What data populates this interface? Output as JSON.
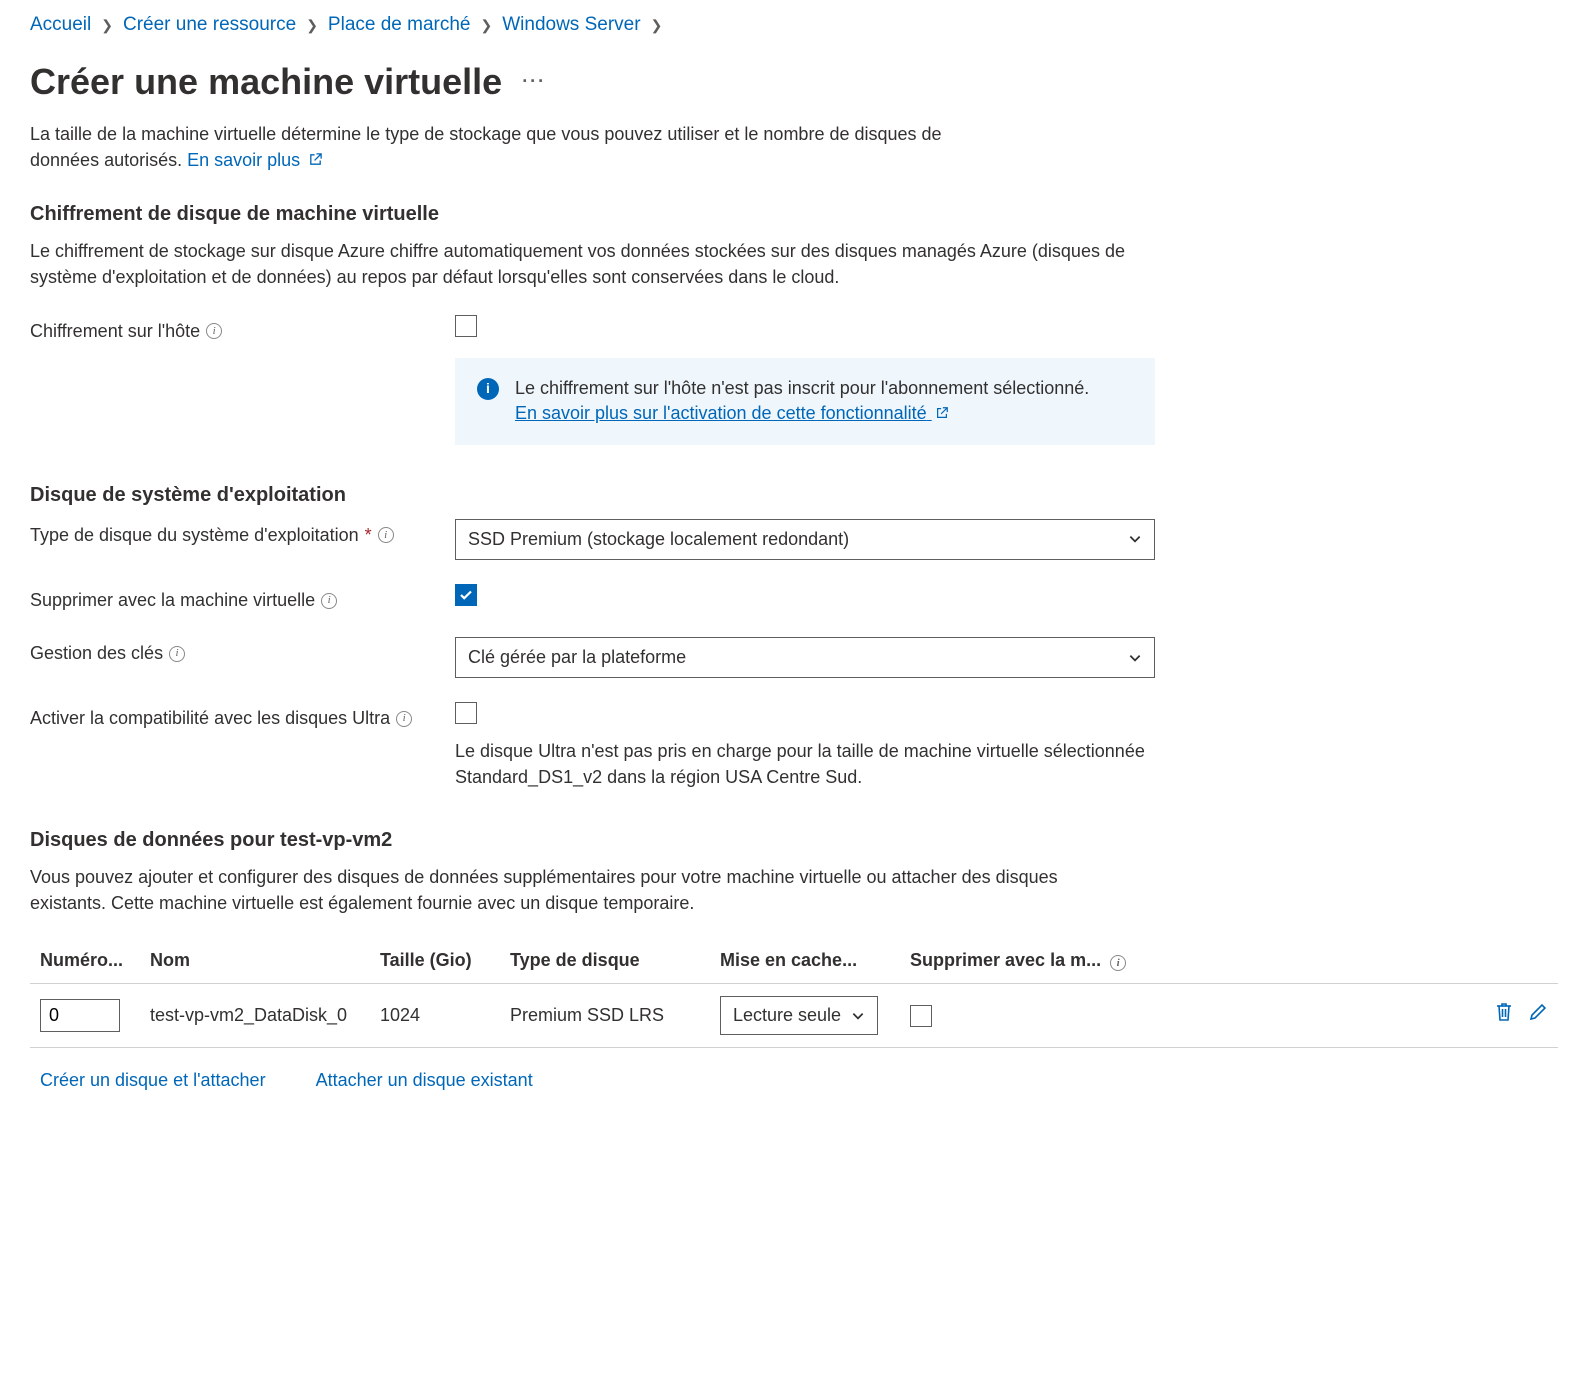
{
  "breadcrumb": {
    "items": [
      "Accueil",
      "Créer une ressource",
      "Place de marché",
      "Windows Server"
    ]
  },
  "page": {
    "title": "Créer une machine virtuelle",
    "intro_text": "La taille de la machine virtuelle détermine le type de stockage que vous pouvez utiliser et le nombre de disques de données autorisés. ",
    "learn_more": "En savoir plus"
  },
  "encryption": {
    "title": "Chiffrement de disque de machine virtuelle",
    "desc": "Le chiffrement de stockage sur disque Azure chiffre automatiquement vos données stockées sur des disques managés Azure (disques de système d'exploitation et de données) au repos par défaut lorsqu'elles sont conservées dans le cloud.",
    "host_label": "Chiffrement sur l'hôte",
    "callout_text": "Le chiffrement sur l'hôte n'est pas inscrit pour l'abonnement sélectionné.",
    "callout_link": "En savoir plus sur l'activation de cette fonctionnalité"
  },
  "osdisk": {
    "title": "Disque de système d'exploitation",
    "type_label": "Type de disque du système d'exploitation",
    "type_value": "SSD Premium (stockage localement redondant)",
    "delete_label": "Supprimer avec la machine virtuelle",
    "keys_label": "Gestion des clés",
    "keys_value": "Clé gérée par la plateforme",
    "ultra_label": "Activer la compatibilité avec les disques Ultra",
    "ultra_help": "Le disque Ultra n'est pas pris en charge pour la taille de machine virtuelle sélectionnée Standard_DS1_v2 dans la région USA Centre Sud."
  },
  "datadisks": {
    "title": "Disques de données pour test-vp-vm2",
    "desc": "Vous pouvez ajouter et configurer des disques de données supplémentaires pour votre machine virtuelle ou attacher des disques existants. Cette machine virtuelle est également fournie avec un disque temporaire.",
    "headers": {
      "lun": "Numéro...",
      "name": "Nom",
      "size": "Taille (Gio)",
      "type": "Type de disque",
      "cache": "Mise en cache...",
      "delete": "Supprimer avec la m..."
    },
    "row": {
      "lun": "0",
      "name": "test-vp-vm2_DataDisk_0",
      "size": "1024",
      "type": "Premium SSD LRS",
      "cache": "Lecture seule"
    },
    "create_link": "Créer un disque et l'attacher",
    "attach_link": "Attacher un disque existant"
  }
}
